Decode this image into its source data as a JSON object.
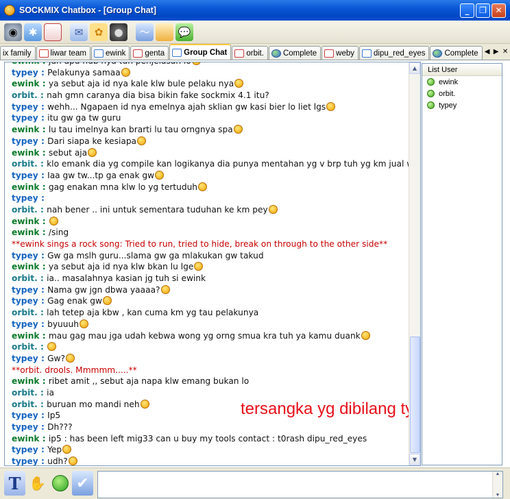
{
  "window": {
    "title": "SOCKMIX Chatbox - [Group Chat]",
    "min_label": "_",
    "restore_label": "❐",
    "close_label": "✕"
  },
  "tabs": [
    {
      "label": "ix family",
      "icon": "none"
    },
    {
      "label": "liwar team",
      "icon": "chat-icon"
    },
    {
      "label": "ewink",
      "icon": "chat-icon"
    },
    {
      "label": "genta",
      "icon": "chat-icon"
    },
    {
      "label": "Group Chat",
      "icon": "group-chat-icon",
      "active": true
    },
    {
      "label": "orbit.",
      "icon": "chat-icon"
    },
    {
      "label": "Complete",
      "icon": "globe-icon"
    },
    {
      "label": "weby",
      "icon": "chat-icon"
    },
    {
      "label": "dipu_red_eyes",
      "icon": "chat-icon"
    },
    {
      "label": "Complete",
      "icon": "globe-icon"
    }
  ],
  "tab_nav": {
    "prev": "◀",
    "next": "▶",
    "close": "✕"
  },
  "chat": [
    {
      "nick": "ewink",
      "text": "juh apu hub nya tuh penjelasan lo"
    },
    {
      "nick": "typey",
      "text": "Pelakunya samaa"
    },
    {
      "nick": "ewink",
      "text": "ya sebut aja id nya kale klw bule pelaku nya"
    },
    {
      "nick": "orbit.",
      "text": "nah gmn caranya dia bisa bikin fake sockmix 4.1 itu?"
    },
    {
      "nick": "typey",
      "text": "wehh... Ngapaen id nya emelnya ajah sklian gw kasi bier lo liet lgs"
    },
    {
      "nick": "typey",
      "text": "itu gw ga tw guru"
    },
    {
      "nick": "ewink",
      "text": "lu tau imelnya kan brarti lu tau orngnya spa"
    },
    {
      "nick": "typey",
      "text": "Dari siapa ke kesiapa"
    },
    {
      "nick": "ewink",
      "text": "sebut aja"
    },
    {
      "nick": "orbit.",
      "text": "klo emank dia yg compile kan logikanya dia punya mentahan yg v brp tuh yg km jual wink"
    },
    {
      "nick": "typey",
      "text": "Iaa gw tw...tp ga enak gw"
    },
    {
      "nick": "ewink",
      "text": "gag enakan mna klw lo yg tertuduh"
    },
    {
      "nick": "typey",
      "text": ""
    },
    {
      "nick": "orbit.",
      "text": "nah  bener .. ini untuk sementara tuduhan ke km pey"
    },
    {
      "nick": "ewink",
      "text": ""
    },
    {
      "nick": "ewink",
      "text": "/sing"
    },
    {
      "action": "**ewink sings a rock song: Tried to run, tried to hide, break on through to the other side**"
    },
    {
      "nick": "typey",
      "text": "Gw ga mslh guru...slama gw ga mlakukan gw takud"
    },
    {
      "nick": "ewink",
      "text": "ya sebut aja id nya klw bkan lu lge"
    },
    {
      "nick": "orbit.",
      "text": "ia.. masalahnya kasian jg tuh si ewink"
    },
    {
      "nick": "typey",
      "text": "Nama gw jgn dbwa yaaaa?"
    },
    {
      "nick": "typey",
      "text": "Gag enak gw"
    },
    {
      "nick": "orbit.",
      "text": "lah tetep aja kbw , kan cuma km yg tau pelakunya"
    },
    {
      "nick": "typey",
      "text": " byuuuh"
    },
    {
      "nick": "ewink",
      "text": "mau gag mau jga udah kebwa  wong yg orng smua kra tuh ya kamu duank"
    },
    {
      "nick": "orbit.",
      "text": ""
    },
    {
      "nick": "typey",
      "text": "Gw?"
    },
    {
      "action": "**orbit. drools. Mmmmm.....**"
    },
    {
      "nick": "ewink",
      "text": "ribet amit ,, sebut aja napa klw emang bukan lo"
    },
    {
      "nick": "orbit.",
      "text": "ia"
    },
    {
      "nick": "orbit.",
      "text": "buruan  mo mandi neh"
    },
    {
      "nick": "typey",
      "text": "Ip5"
    },
    {
      "nick": "typey",
      "text": "Dh???"
    },
    {
      "nick": "ewink",
      "text": "ip5 : has been left mig33 can u buy my tools contact : t0rash dipu_red_eyes"
    },
    {
      "nick": "typey",
      "text": "Yep"
    },
    {
      "nick": "typey",
      "text": " udh?"
    }
  ],
  "emoticon_lines": [
    0,
    1,
    2,
    4,
    6,
    7,
    8,
    10,
    11,
    13,
    14,
    18,
    20,
    21,
    23,
    24,
    25,
    26,
    30,
    34,
    35
  ],
  "annotation": "tersangka yg dibilang typey",
  "userlist": {
    "header": "List User",
    "users": [
      "ewink",
      "orbit.",
      "typey"
    ]
  },
  "colors": {
    "ewink": "#0a7a2a",
    "typey": "#1565c0",
    "orbit": "#1a7a8a",
    "action": "#c80000",
    "annotation": "#e8101a"
  }
}
